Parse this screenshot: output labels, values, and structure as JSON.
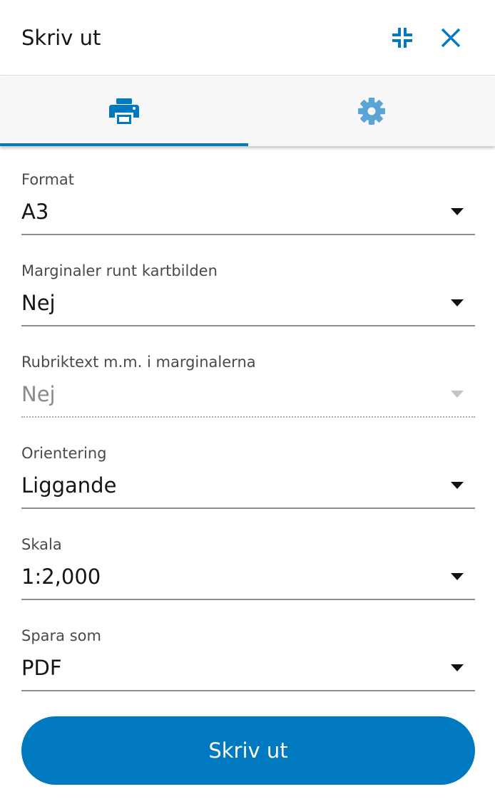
{
  "header": {
    "title": "Skriv ut",
    "collapse_icon": "collapse-icon",
    "close_icon": "close-icon"
  },
  "tabs": [
    {
      "icon": "printer-icon",
      "active": true
    },
    {
      "icon": "gear-icon",
      "active": false
    }
  ],
  "form": {
    "format": {
      "label": "Format",
      "value": "A3"
    },
    "margins": {
      "label": "Marginaler runt kartbilden",
      "value": "Nej"
    },
    "margin_text": {
      "label": "Rubriktext m.m. i marginalerna",
      "value": "Nej",
      "disabled": true
    },
    "orientation": {
      "label": "Orientering",
      "value": "Liggande"
    },
    "scale": {
      "label": "Skala",
      "value": "1:2,000"
    },
    "save_as": {
      "label": "Spara som",
      "value": "PDF"
    }
  },
  "actions": {
    "print_label": "Skriv ut"
  },
  "colors": {
    "accent": "#0079c1",
    "settings_icon": "#5aa5d6",
    "text": "#151515",
    "label": "#4a4a4a",
    "disabled": "#8a8a8a"
  }
}
